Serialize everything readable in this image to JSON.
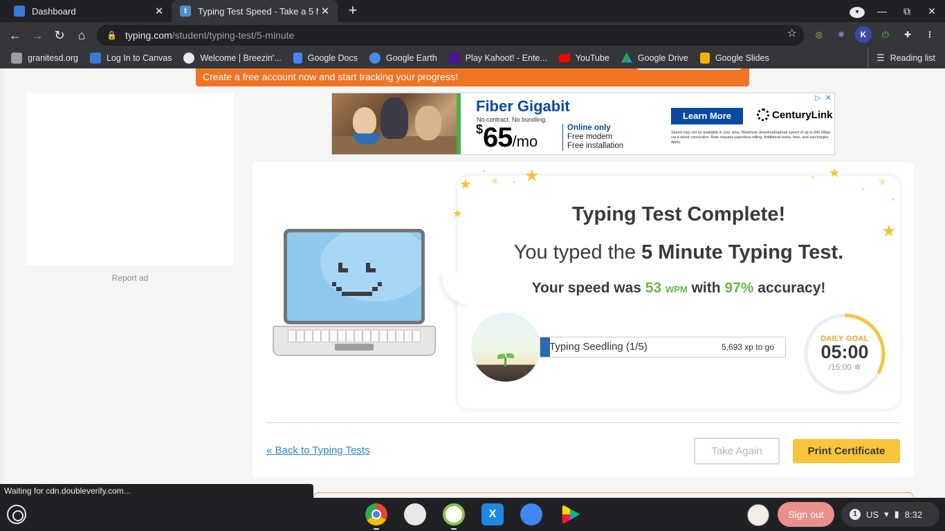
{
  "browser": {
    "tabs": [
      {
        "label": "Dashboard",
        "close": "✕"
      },
      {
        "label": "Typing Test Speed - Take a 5 Minu",
        "close": "✕"
      }
    ],
    "new_tab": "+",
    "url_host": "typing.com",
    "url_path": "/student/typing-test/5-minute",
    "bookmarks": [
      {
        "label": "granitesd.org",
        "icon_color": "#9e9e9e"
      },
      {
        "label": "Log In to Canvas",
        "icon_color": "#3c78d8"
      },
      {
        "label": "Welcome | Breezin'...",
        "icon_color": "#e8eaed"
      },
      {
        "label": "Google Docs",
        "icon_color": "#4285f4"
      },
      {
        "label": "Google Earth",
        "icon_color": "#4a8de6"
      },
      {
        "label": "Play Kahoot! - Ente...",
        "icon_color": "#46178f"
      },
      {
        "label": "YouTube",
        "icon_color": "#ff0000"
      },
      {
        "label": "Google Drive",
        "icon_color": "#1fa463"
      },
      {
        "label": "Google Slides",
        "icon_color": "#f4b400"
      }
    ],
    "reading_list": "Reading list",
    "extensions": [
      {
        "icon": "circle-icon",
        "color": "#c0ca33",
        "glyph": "◎"
      },
      {
        "icon": "gear-icon",
        "color": "#5c6bc0",
        "glyph": "✺"
      },
      {
        "icon": "k-icon",
        "color": "#3949ab",
        "glyph": "K"
      },
      {
        "icon": "power-icon",
        "color": "#2e7d32",
        "glyph": "⏻"
      },
      {
        "icon": "puzzle-icon",
        "color": "#35363a",
        "glyph": "✚"
      }
    ],
    "status_text": "Waiting for cdn.doubleverify.com..."
  },
  "page": {
    "banner_text": "Create a free account now and start tracking your progress!",
    "report_ad": "Report ad",
    "ad": {
      "headline": "Fiber Gigabit",
      "subline": "No contract. No bundling.",
      "price_symbol": "$",
      "price": "65",
      "price_unit": "/mo",
      "offer1": "Online only",
      "offer2": "Free modem",
      "offer3": "Free installation",
      "cta": "Learn More",
      "brand": "CenturyLink",
      "fine_print": "Speed may not be available in your area. Maximum download/upload speed of up to 940 Mbps via a wired connection. Rate requires paperless billing. Additional taxes, fees, and surcharges apply."
    },
    "result": {
      "title": "Typing Test Complete!",
      "typed_prefix": "You typed the ",
      "typed_test": "5 Minute Typing Test.",
      "speed_prefix": "Your speed was ",
      "wpm": "53",
      "wpm_unit": "WPM",
      "speed_mid": " with ",
      "accuracy": "97%",
      "speed_suffix": " accuracy!"
    },
    "level": {
      "name": "Typing Seedling (1/5)",
      "xp": "5,693 xp to go",
      "progress": 0.04
    },
    "daily_goal": {
      "label": "DAILY GOAL",
      "time": "05:00",
      "total": "/15:00",
      "progress": 0.333
    },
    "back_link": "« Back to Typing Tests",
    "take_again": "Take Again",
    "print_certificate": "Print Certificate"
  },
  "shelf": {
    "sign_out": "Sign out",
    "notifications": "1",
    "keyboard": "US",
    "time": "8:32",
    "apps": [
      {
        "name": "chrome-app",
        "color": "#4285f4"
      },
      {
        "name": "photos-app",
        "color": "#e8e8e8"
      },
      {
        "name": "cycle-app",
        "color": "#ffffff"
      },
      {
        "name": "x-app",
        "color": "#1e88e5"
      },
      {
        "name": "docs-app",
        "color": "#4285f4"
      },
      {
        "name": "play-store-app",
        "color": "#ffffff"
      }
    ]
  }
}
